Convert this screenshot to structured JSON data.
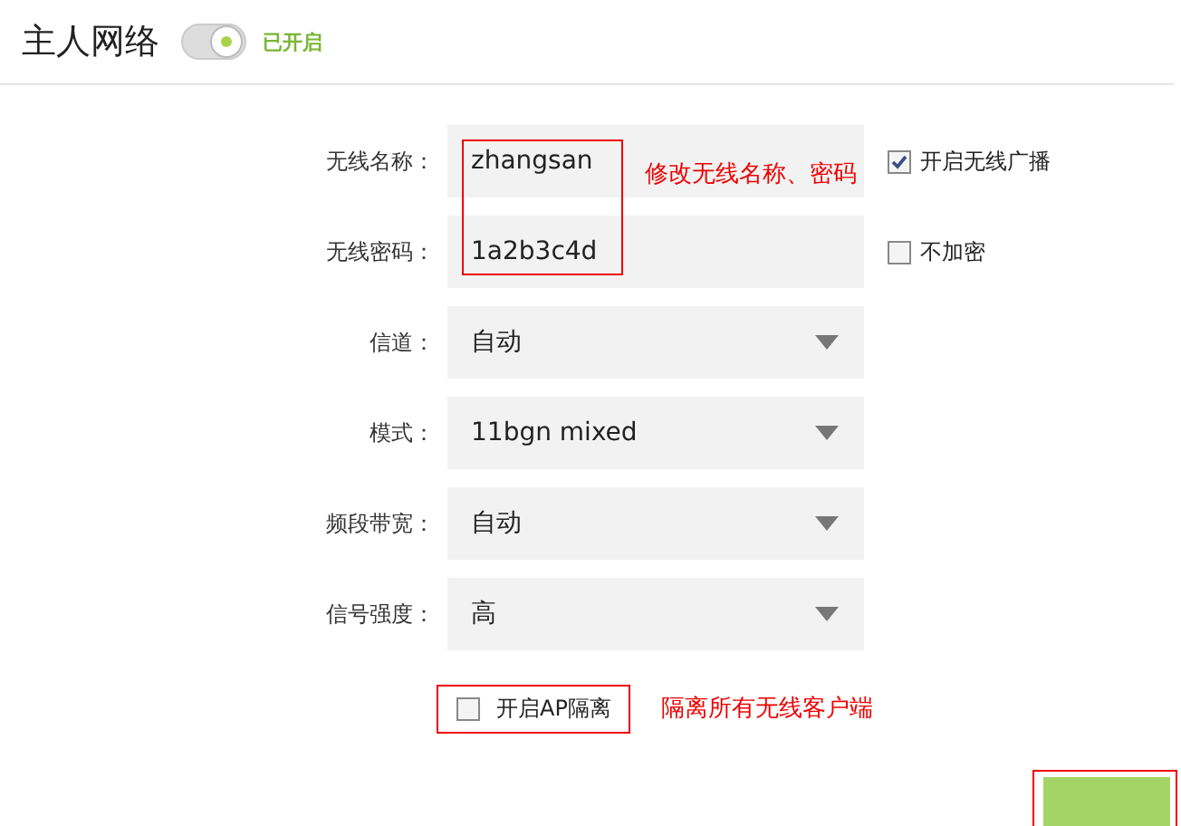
{
  "header": {
    "title": "主人网络",
    "toggle": {
      "on": true,
      "label": "已开启"
    }
  },
  "fields": [
    {
      "kind": "text",
      "label": "无线名称：",
      "value": "zhangsan",
      "option": {
        "label": "开启无线广播",
        "checked": true
      }
    },
    {
      "kind": "text",
      "label": "无线密码：",
      "value": "1a2b3c4d",
      "option": {
        "label": "不加密",
        "checked": false
      }
    },
    {
      "kind": "select",
      "label": "信道：",
      "value": "自动"
    },
    {
      "kind": "select",
      "label": "模式：",
      "value": "11bgn mixed"
    },
    {
      "kind": "select",
      "label": "频段带宽：",
      "value": "自动"
    },
    {
      "kind": "select",
      "label": "信号强度：",
      "value": "高"
    }
  ],
  "ap_isolation": {
    "label": "开启AP隔离",
    "checked": false
  },
  "annotations": [
    "修改无线名称、密码",
    "隔离所有无线客户端"
  ]
}
